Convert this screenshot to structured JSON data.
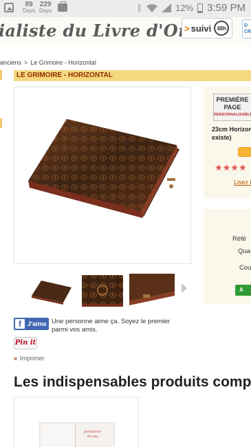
{
  "status_bar": {
    "days1_number": "89",
    "days1_label": "Days",
    "days2_number": "229",
    "days2_label": "Days",
    "battery": "12%",
    "time": "3:59 PM",
    "icons": [
      "image-icon",
      "briefcase-icon",
      "bluetooth-icon",
      "wifi-icon",
      "signal-icon",
      "battery-icon"
    ]
  },
  "header": {
    "site_title": "ialiste du Livre d'Or",
    "suivi_label": "suivi",
    "suivi_badge": "48h"
  },
  "breadcrumb": {
    "parent": "anciens",
    "separator": ">",
    "current": "Le Grimoire - Horizontal"
  },
  "product": {
    "title": "LE GRIMOIRE - HORIZONTAL"
  },
  "right_panel": {
    "premiere_line1": "PREMIÈRE",
    "premiere_line2": "PAGE",
    "premiere_line3": "PERSONNALISABLE",
    "size_line1": "23cm Horizon",
    "size_line2": "existe)",
    "rating_stars": "★★★★",
    "rating_value": 4,
    "reviews_link": "Lisez l",
    "ref_label": "Réfé",
    "qty_label": "Qua",
    "cou_label": "Cou",
    "green_button": "A"
  },
  "social": {
    "fb_button": "J'aime",
    "fb_text": "Une personne aime ça. Soyez le premier parmi vos amis.",
    "pin_button": "Pin it",
    "print_link": "Imprimer"
  },
  "section_title": "Les indispensables produits complé",
  "card": {
    "album_text_line1": "Joséphine",
    "album_text_line2": "30 ans"
  },
  "colors": {
    "title_bar": "#f6d87e",
    "title_text": "#8b2d00",
    "facebook": "#4267b2",
    "pinterest": "#bd081c",
    "stars": "#e05050",
    "green_button": "#2e9b34"
  }
}
